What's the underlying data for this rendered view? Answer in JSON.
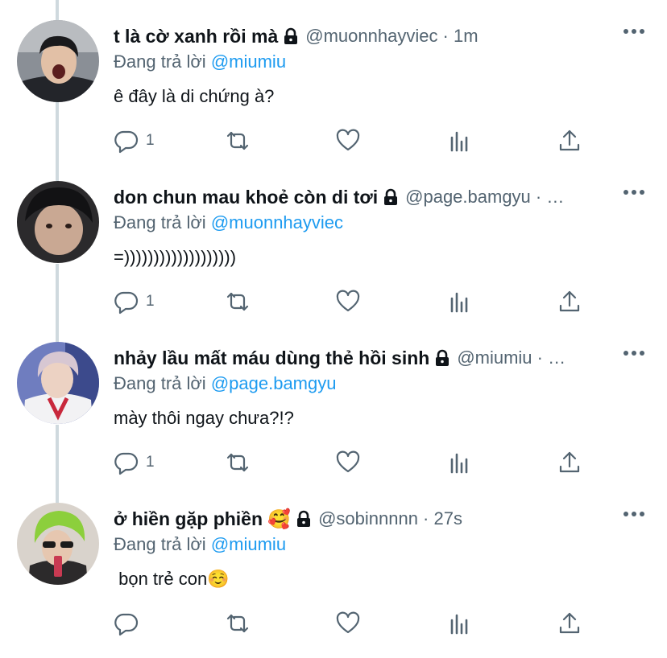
{
  "colors": {
    "accent": "#1d9bf0",
    "secondary_text": "#536471",
    "thread_line": "#cfd9de"
  },
  "tweets": [
    {
      "name": "t là cờ xanh rồi mà",
      "lock": "lock-icon",
      "handle": "@muonnhayviec · 1m",
      "reply_prefix": "Đang trả lời",
      "mention": "@miumiu",
      "text": "ê đây là di chứng à?",
      "reply_count": "1"
    },
    {
      "name": "don chun mau khoẻ còn di tơi",
      "lock": "lock-icon",
      "handle": "@page.bamgyu · …",
      "reply_prefix": "Đang trả lời",
      "mention": "@muonnhayviec",
      "text": "=)))))))))))))))))))",
      "reply_count": "1"
    },
    {
      "name": "nhảy lầu mất máu dùng thẻ hồi sinh",
      "lock": "lock-icon",
      "handle": "@miumiu · …",
      "reply_prefix": "Đang trả lời",
      "mention": "@page.bamgyu",
      "text": "mày thôi ngay chưa?!?",
      "reply_count": "1"
    },
    {
      "name": "ở hiền gặp phiền 🥰",
      "lock": "lock-icon",
      "handle": "@sobinnnnn · 27s",
      "reply_prefix": "Đang trả lời",
      "mention": "@miumiu",
      "text": " bọn trẻ con☺️",
      "reply_count": ""
    }
  ]
}
